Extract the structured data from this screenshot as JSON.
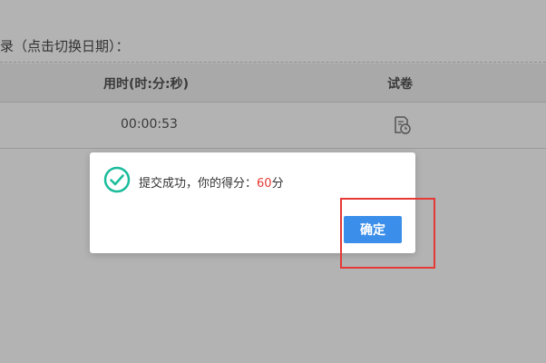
{
  "background": {
    "section_title": "录（点击切换日期）：",
    "table": {
      "columns": [
        "用时(时:分:秒)",
        "试卷"
      ],
      "rows": [
        {
          "time": "00:00:53",
          "paper_icon": "document-clock-icon"
        }
      ]
    }
  },
  "dialog": {
    "icon": "check-circle-icon",
    "message_prefix": "提交成功，你的得分：",
    "score": "60",
    "score_unit": "分",
    "confirm_label": "确定"
  },
  "colors": {
    "overlay_bg": "#b3b3b3",
    "accent": "#3b8fea",
    "check": "#1abc9c",
    "score": "#e53935",
    "highlight": "#e53935"
  }
}
